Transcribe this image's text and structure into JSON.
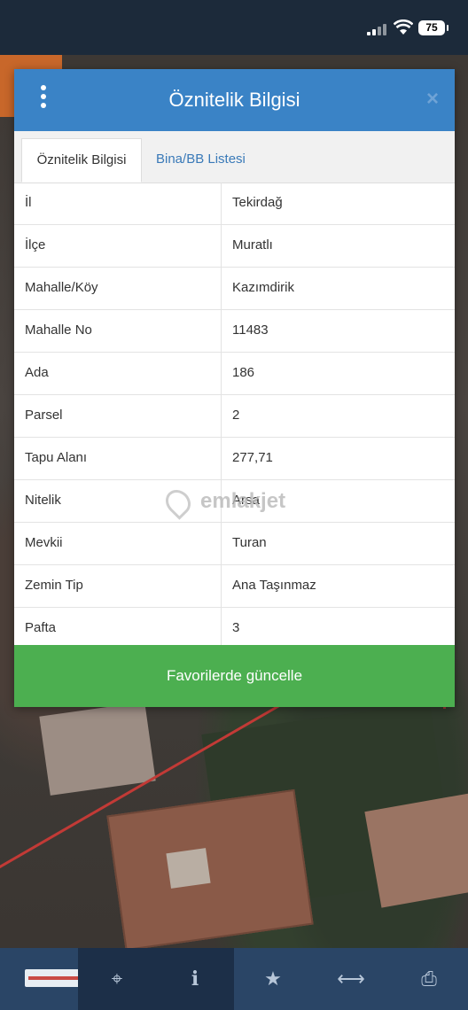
{
  "status_bar": {
    "battery": "75"
  },
  "modal": {
    "title": "Öznitelik Bilgisi",
    "close": "×",
    "tabs": [
      {
        "label": "Öznitelik Bilgisi",
        "active": true
      },
      {
        "label": "Bina/BB Listesi",
        "active": false
      }
    ],
    "rows": [
      {
        "key": "İl",
        "value": "Tekirdağ"
      },
      {
        "key": "İlçe",
        "value": "Muratlı"
      },
      {
        "key": "Mahalle/Köy",
        "value": "Kazımdirik"
      },
      {
        "key": "Mahalle No",
        "value": "11483"
      },
      {
        "key": "Ada",
        "value": "186"
      },
      {
        "key": "Parsel",
        "value": "2"
      },
      {
        "key": "Tapu Alanı",
        "value": "277,71"
      },
      {
        "key": "Nitelik",
        "value": "Arsa"
      },
      {
        "key": "Mevkii",
        "value": "Turan"
      },
      {
        "key": "Zemin Tip",
        "value": "Ana Taşınmaz"
      },
      {
        "key": "Pafta",
        "value": "3"
      }
    ],
    "button": "Favorilerde güncelle"
  },
  "watermark": "emlakjet",
  "toolbar": {
    "icons": [
      "logo",
      "locate-icon",
      "info-icon",
      "star-icon",
      "measure-icon",
      "print-icon"
    ],
    "glyphs": {
      "locate": "⌖",
      "info": "i",
      "star": "★",
      "measure": "⟷",
      "print": "⎙"
    }
  },
  "colors": {
    "header": "#3a83c6",
    "button": "#4caf50",
    "toolbar": "#2a4566"
  }
}
